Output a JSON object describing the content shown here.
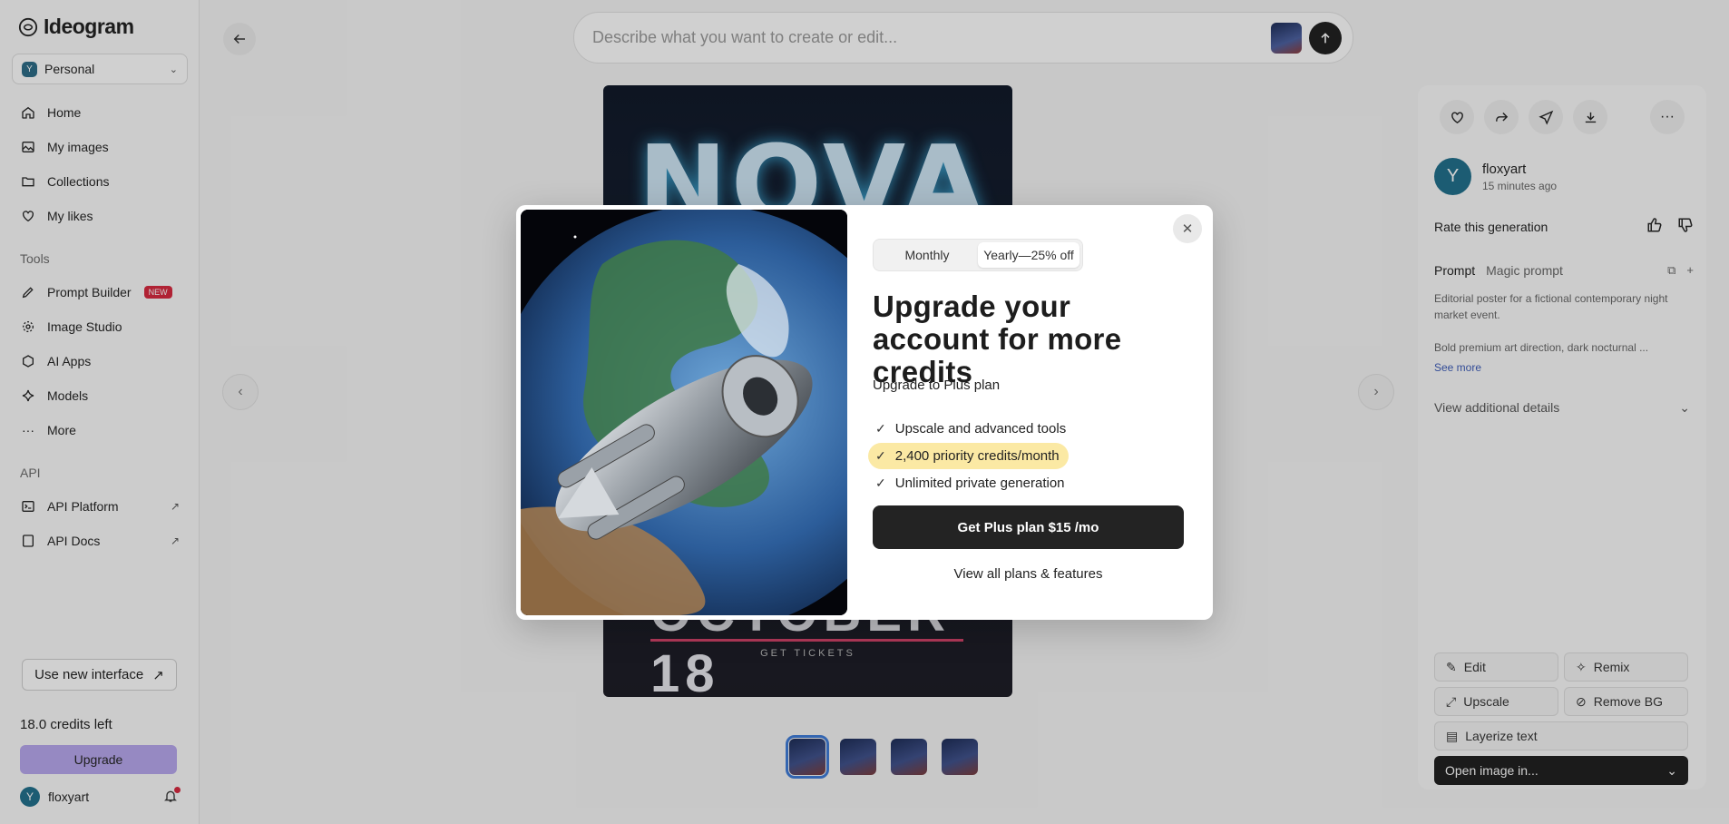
{
  "app": {
    "logo_text": "Ideogram"
  },
  "sidebar": {
    "workspace": {
      "badge": "Y",
      "name": "Personal"
    },
    "main_items": [
      {
        "label": "Home",
        "icon": "home-icon"
      },
      {
        "label": "My images",
        "icon": "images-icon"
      },
      {
        "label": "Collections",
        "icon": "folder-icon"
      },
      {
        "label": "My likes",
        "icon": "heart-icon"
      }
    ],
    "tools_heading": "Tools",
    "tools": [
      {
        "label": "Prompt Builder",
        "badge": "NEW"
      },
      {
        "label": "Image Studio"
      },
      {
        "label": "AI Apps"
      },
      {
        "label": "Models"
      },
      {
        "label": "More"
      }
    ],
    "api_heading": "API",
    "api_items": [
      {
        "label": "API Platform"
      },
      {
        "label": "API Docs"
      }
    ],
    "use_new_interface": "Use new interface",
    "credits": "18.0 credits left",
    "upgrade": "Upgrade",
    "user": {
      "initial": "Y",
      "name": "floxyart"
    }
  },
  "prompt_bar": {
    "placeholder": "Describe what you want to create or edit..."
  },
  "poster": {
    "title": "NOVA",
    "date": "OCTOBER 18",
    "tickets": "GET TICKETS"
  },
  "right_panel": {
    "user": {
      "initial": "Y",
      "name": "floxyart",
      "time": "15 minutes ago"
    },
    "rate_label": "Rate this generation",
    "tabs": {
      "prompt": "Prompt",
      "magic": "Magic prompt"
    },
    "prompt_text_1": "Editorial poster for a fictional contemporary night market event.",
    "prompt_text_2": "Bold premium art direction, dark nocturnal ...",
    "see_more": "See more",
    "details": "View additional details",
    "actions": {
      "edit": "Edit",
      "remix": "Remix",
      "upscale": "Upscale",
      "remove_bg": "Remove BG",
      "layerize": "Layerize text"
    },
    "open_in": "Open image in..."
  },
  "modal": {
    "billing": {
      "monthly": "Monthly",
      "yearly": "Yearly—25% off",
      "selected": "yearly"
    },
    "headline": "Upgrade your account for more credits",
    "subhead": "Upgrade to Plus plan",
    "features": [
      {
        "text": "Upscale and advanced tools",
        "highlight": false
      },
      {
        "text": "2,400 priority credits/month",
        "highlight": true
      },
      {
        "text": "Unlimited private generation",
        "highlight": false
      }
    ],
    "cta": "Get Plus plan $15 /mo",
    "view_all": "View all plans & features"
  },
  "colors": {
    "highlight": "#fbe9a4",
    "cta": "#232323",
    "upgrade_button": "#b7a7ee",
    "accent_blue": "#3d7bd9"
  }
}
